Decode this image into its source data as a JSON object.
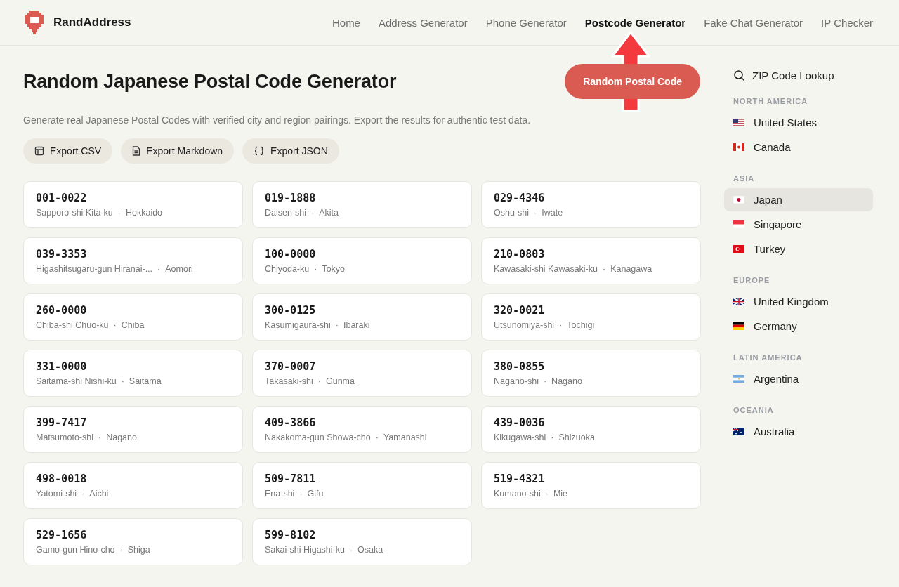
{
  "brand": "RandAddress",
  "nav": [
    {
      "label": "Home",
      "selected": false
    },
    {
      "label": "Address Generator",
      "selected": false
    },
    {
      "label": "Phone Generator",
      "selected": false
    },
    {
      "label": "Postcode Generator",
      "selected": true
    },
    {
      "label": "Fake Chat Generator",
      "selected": false
    },
    {
      "label": "IP Checker",
      "selected": false
    }
  ],
  "title": "Random Japanese Postal Code Generator",
  "primary_button": "Random Postal Code",
  "description": "Generate real Japanese Postal Codes with verified city and region pairings. Export the results for authentic test data.",
  "exports": [
    {
      "kind": "table",
      "label": "Export CSV"
    },
    {
      "kind": "doc",
      "label": "Export Markdown"
    },
    {
      "kind": "braces",
      "label": "Export JSON"
    }
  ],
  "codes": [
    {
      "code": "001-0022",
      "city": "Sapporo-shi Kita-ku",
      "separator": "·",
      "region": "Hokkaido"
    },
    {
      "code": "019-1888",
      "city": "Daisen-shi",
      "separator": "·",
      "region": "Akita"
    },
    {
      "code": "029-4346",
      "city": "Oshu-shi",
      "separator": "·",
      "region": "Iwate"
    },
    {
      "code": "039-3353",
      "city": "Higashitsugaru-gun Hiranai-...",
      "separator": "·",
      "region": "Aomori"
    },
    {
      "code": "100-0000",
      "city": "Chiyoda-ku",
      "separator": "·",
      "region": "Tokyo"
    },
    {
      "code": "210-0803",
      "city": "Kawasaki-shi Kawasaki-ku",
      "separator": "·",
      "region": "Kanagawa"
    },
    {
      "code": "260-0000",
      "city": "Chiba-shi Chuo-ku",
      "separator": "·",
      "region": "Chiba"
    },
    {
      "code": "300-0125",
      "city": "Kasumigaura-shi",
      "separator": "·",
      "region": "Ibaraki"
    },
    {
      "code": "320-0021",
      "city": "Utsunomiya-shi",
      "separator": "·",
      "region": "Tochigi"
    },
    {
      "code": "331-0000",
      "city": "Saitama-shi Nishi-ku",
      "separator": "·",
      "region": "Saitama"
    },
    {
      "code": "370-0007",
      "city": "Takasaki-shi",
      "separator": "·",
      "region": "Gunma"
    },
    {
      "code": "380-0855",
      "city": "Nagano-shi",
      "separator": "·",
      "region": "Nagano"
    },
    {
      "code": "399-7417",
      "city": "Matsumoto-shi",
      "separator": "·",
      "region": "Nagano"
    },
    {
      "code": "409-3866",
      "city": "Nakakoma-gun Showa-cho",
      "separator": "·",
      "region": "Yamanashi"
    },
    {
      "code": "439-0036",
      "city": "Kikugawa-shi",
      "separator": "·",
      "region": "Shizuoka"
    },
    {
      "code": "498-0018",
      "city": "Yatomi-shi",
      "separator": "·",
      "region": "Aichi"
    },
    {
      "code": "509-7811",
      "city": "Ena-shi",
      "separator": "·",
      "region": "Gifu"
    },
    {
      "code": "519-4321",
      "city": "Kumano-shi",
      "separator": "·",
      "region": "Mie"
    },
    {
      "code": "529-1656",
      "city": "Gamo-gun Hino-cho",
      "separator": "·",
      "region": "Shiga"
    },
    {
      "code": "599-8102",
      "city": "Sakai-shi Higashi-ku",
      "separator": "·",
      "region": "Osaka"
    }
  ],
  "sidebar": {
    "lookup": "ZIP Code Lookup",
    "groups": [
      {
        "heading": "NORTH AMERICA",
        "items": [
          {
            "kind": "us",
            "label": "United States",
            "selected": false
          },
          {
            "kind": "ca",
            "label": "Canada",
            "selected": false
          }
        ]
      },
      {
        "heading": "ASIA",
        "items": [
          {
            "kind": "jp",
            "label": "Japan",
            "selected": true
          },
          {
            "kind": "sg",
            "label": "Singapore",
            "selected": false
          },
          {
            "kind": "tr",
            "label": "Turkey",
            "selected": false
          }
        ]
      },
      {
        "heading": "EUROPE",
        "items": [
          {
            "kind": "gb",
            "label": "United Kingdom",
            "selected": false
          },
          {
            "kind": "de",
            "label": "Germany",
            "selected": false
          }
        ]
      },
      {
        "heading": "LATIN AMERICA",
        "items": [
          {
            "kind": "ar",
            "label": "Argentina",
            "selected": false
          }
        ]
      },
      {
        "heading": "OCEANIA",
        "items": [
          {
            "kind": "au",
            "label": "Australia",
            "selected": false
          }
        ]
      }
    ]
  }
}
